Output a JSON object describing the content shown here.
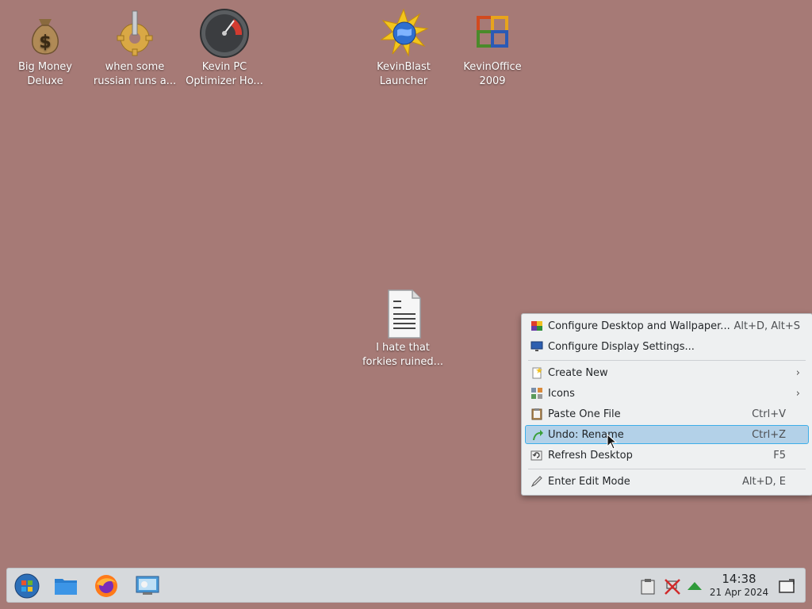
{
  "desktop": {
    "icons": [
      {
        "name": "icon-big-money-deluxe",
        "label": "Big Money\nDeluxe"
      },
      {
        "name": "icon-russian",
        "label": "when some\nrussian runs a..."
      },
      {
        "name": "icon-kevin-pc-optimizer",
        "label": "Kevin PC\nOptimizer Ho..."
      },
      {
        "name": "icon-kevinblast-launcher",
        "label": "KevinBlast\nLauncher"
      },
      {
        "name": "icon-kevinoffice-2009",
        "label": "KevinOffice\n2009"
      },
      {
        "name": "icon-text-file",
        "label": "I hate that\nforkies ruined..."
      }
    ]
  },
  "context_menu": {
    "items": [
      {
        "label": "Configure Desktop and Wallpaper...",
        "shortcut": "Alt+D, Alt+S"
      },
      {
        "label": "Configure Display Settings...",
        "shortcut": ""
      },
      {
        "label": "Create New",
        "shortcut": ""
      },
      {
        "label": "Icons",
        "shortcut": ""
      },
      {
        "label": "Paste One File",
        "shortcut": "Ctrl+V"
      },
      {
        "label": "Undo: Rename",
        "shortcut": "Ctrl+Z"
      },
      {
        "label": "Refresh Desktop",
        "shortcut": "F5"
      },
      {
        "label": "Enter Edit Mode",
        "shortcut": "Alt+D, E"
      }
    ]
  },
  "taskbar": {
    "clock_time": "14:38",
    "clock_date": "21 Apr 2024"
  },
  "colors": {
    "desktop_background": "#a67a76",
    "menu_highlight": "#b3d1e8",
    "menu_highlight_border": "#3daee9"
  }
}
